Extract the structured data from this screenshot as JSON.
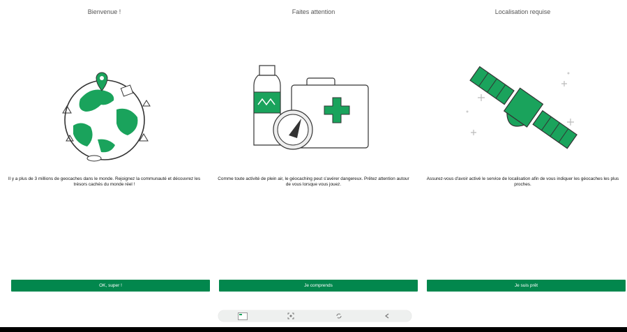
{
  "panels": [
    {
      "title": "Bienvenue !",
      "description": "Il y a plus de 3 millions de geocaches dans le monde. Rejoignez la communauté et découvrez les trésors cachés du monde réel !",
      "button_label": "OK, super !"
    },
    {
      "title": "Faites attention",
      "description": "Comme toute activité de plein air, le géocaching peut s'avérer dangereux. Prêtez attention autour de vous lorsque vous jouez.",
      "button_label": "Je comprends"
    },
    {
      "title": "Localisation requise",
      "description": "Assurez-vous d'avoir activé le service de localisation afin de vous indiquer les géocaches les plus proches.",
      "button_label": "Je suis prêt"
    }
  ],
  "colors": {
    "brand_green": "#02874d",
    "illustration_green": "#1aa35c"
  },
  "toolbar": {
    "icons": [
      "app-thumbnail-icon",
      "screenshot-icon",
      "rotate-icon",
      "share-icon"
    ]
  }
}
